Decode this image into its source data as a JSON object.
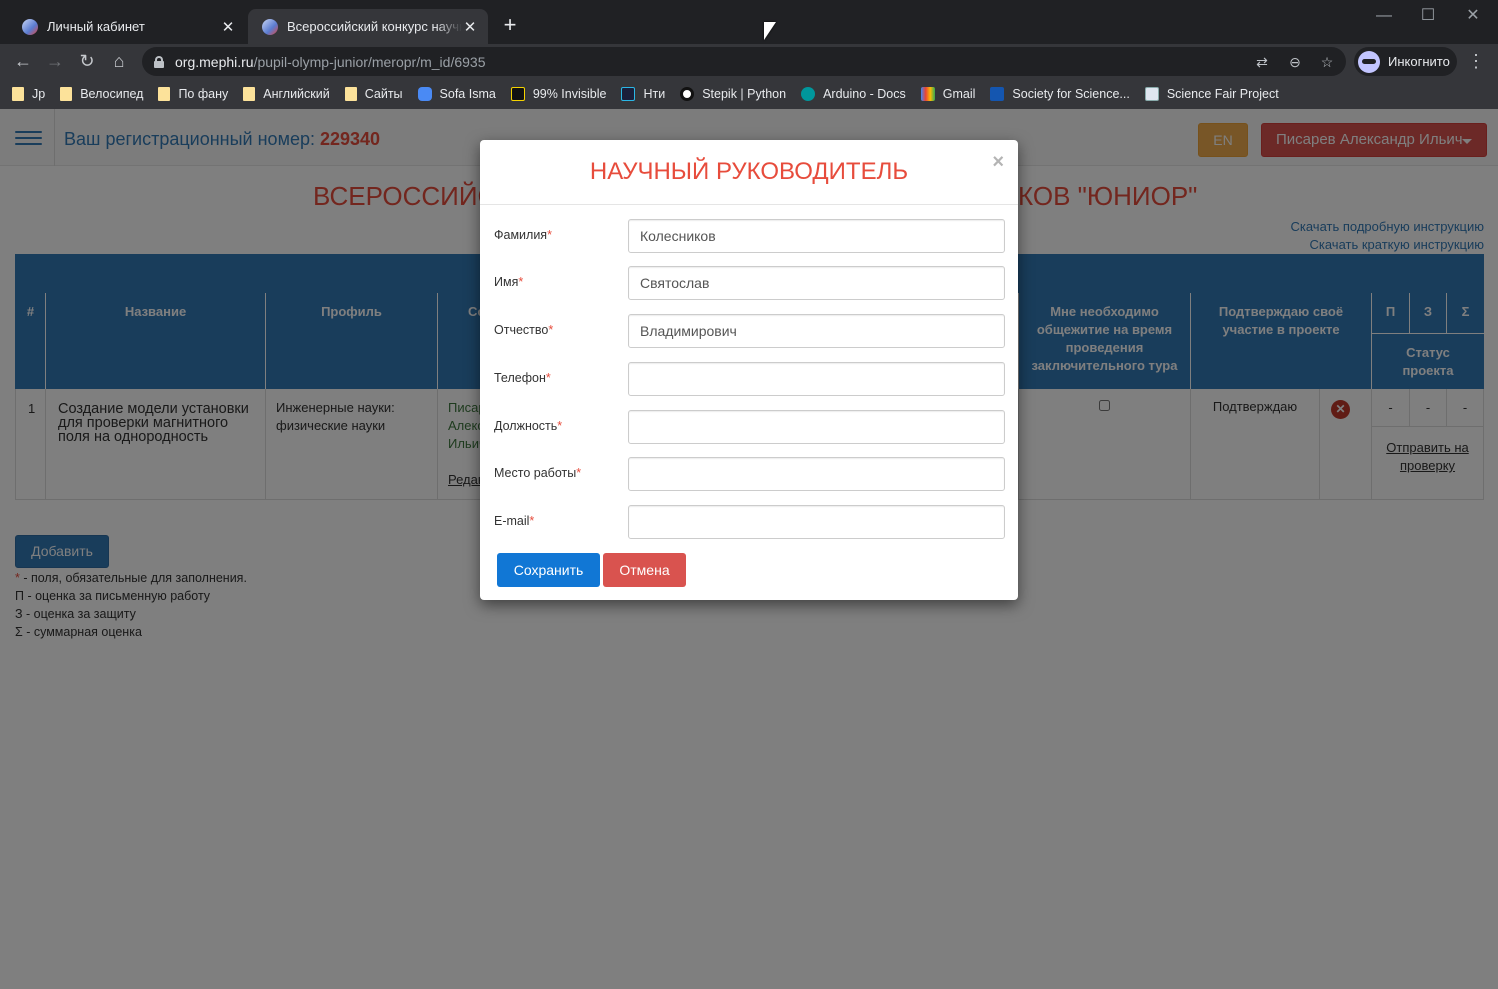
{
  "tabs": [
    {
      "title": "Личный кабинет"
    },
    {
      "title": "Всероссийский конкурс научных"
    }
  ],
  "toolbar": {
    "url_domain": "org.mephi.ru",
    "url_path": "/pupil-olymp-junior/meropr/m_id/6935",
    "incognito_label": "Инкогнито"
  },
  "bookmarks": [
    {
      "label": "Jp",
      "icon": "folder-icon"
    },
    {
      "label": "Велосипед",
      "icon": "folder-icon"
    },
    {
      "label": "По фану",
      "icon": "folder-icon"
    },
    {
      "label": "Английский",
      "icon": "folder-icon"
    },
    {
      "label": "Сайты",
      "icon": "folder-icon"
    },
    {
      "label": "Sofa Isma",
      "icon": "chat-icon"
    },
    {
      "label": "99% Invisible",
      "icon": "podcast-icon"
    },
    {
      "label": "Нти",
      "icon": "nti-icon"
    },
    {
      "label": "Stepik | Python",
      "icon": "stepik-icon"
    },
    {
      "label": "Arduino - Docs",
      "icon": "arduino-icon"
    },
    {
      "label": "Gmail",
      "icon": "gmail-icon"
    },
    {
      "label": "Society for Science...",
      "icon": "society-icon"
    },
    {
      "label": "Science Fair Project",
      "icon": "science-icon"
    }
  ],
  "header": {
    "reg_label": "Ваш регистрационный номер:",
    "reg_number": "229340",
    "lang_button": "EN",
    "user_name": "Писарев Александр Ильич"
  },
  "page": {
    "title_left": "ВСЕРОССИЙС",
    "title_right": "КОВ \"ЮНИОР\"",
    "link_full": "Скачать подробную инструкцию",
    "link_short": "Скачать краткую инструкцию"
  },
  "table": {
    "headers": {
      "num": "#",
      "name": "Название",
      "profile": "Профиль",
      "co": "Со",
      "dorm": "Мне необходимо общежитие на время проведения заключительного тура",
      "confirm": "Подтверждаю своё участие в проекте",
      "p": "П",
      "z": "З",
      "s": "Σ",
      "status": "Статус проекта"
    },
    "row": {
      "num": "1",
      "name": "Создание модели установки для проверки магнитного поля на однородность",
      "profile": "Инженерные науки: физические науки",
      "co_line1": "Писар",
      "co_line2": "Алекс",
      "co_line3": "Ильич",
      "co_edit": "Редак",
      "confirm": "Подтверждаю",
      "p": "-",
      "z": "-",
      "s": "-",
      "send": "Отправить на проверку"
    }
  },
  "add_button": "Добавить",
  "legend": {
    "req_star": "*",
    "req_text": " - поля, обязательные для заполнения.",
    "p": "П - оценка за письменную работу",
    "z": "З - оценка за защиту",
    "s": "Σ - суммарная оценка"
  },
  "modal": {
    "title": "НАУЧНЫЙ РУКОВОДИТЕЛЬ",
    "close": "×",
    "fields": [
      {
        "label": "Фамилия",
        "value": "Колесников"
      },
      {
        "label": "Имя",
        "value": "Святослав"
      },
      {
        "label": "Отчество",
        "value": "Владимирович"
      },
      {
        "label": "Телефон",
        "value": ""
      },
      {
        "label": "Должность",
        "value": ""
      },
      {
        "label": "Место работы",
        "value": ""
      },
      {
        "label": "E-mail",
        "value": ""
      }
    ],
    "req_star": "*",
    "save": "Сохранить",
    "cancel": "Отмена"
  }
}
